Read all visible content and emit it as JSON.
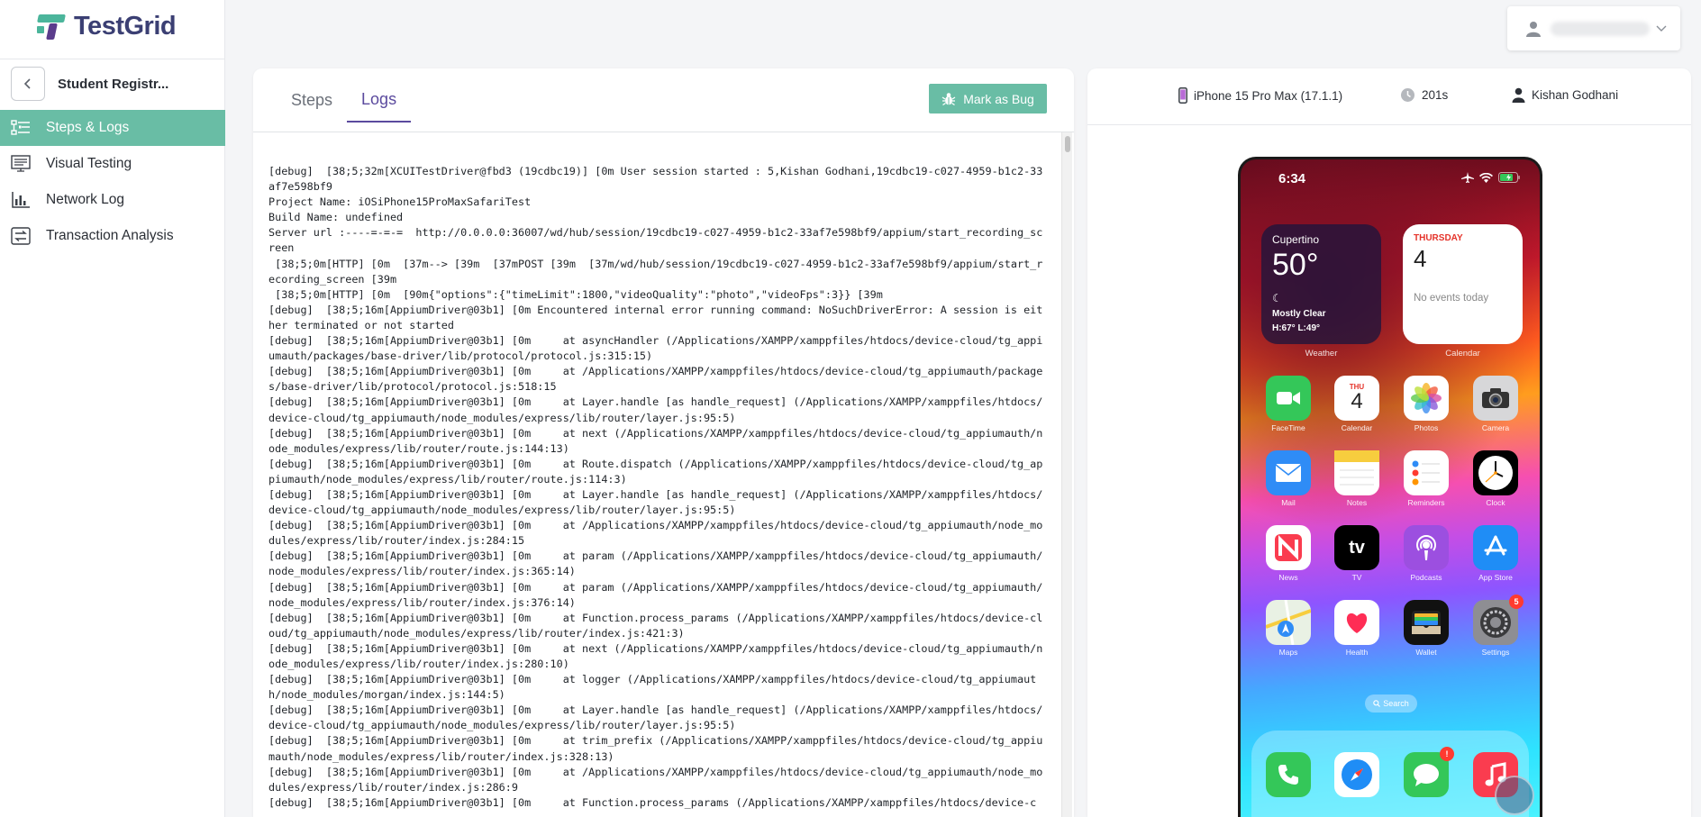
{
  "brand": {
    "name": "TestGrid"
  },
  "sidebar": {
    "project_name": "Student Registr...",
    "items": [
      {
        "label": "Steps & Logs",
        "icon": "steps-logs-icon",
        "active": true
      },
      {
        "label": "Visual Testing",
        "icon": "visual-testing-icon",
        "active": false
      },
      {
        "label": "Network Log",
        "icon": "network-log-icon",
        "active": false
      },
      {
        "label": "Transaction Analysis",
        "icon": "transaction-analysis-icon",
        "active": false
      }
    ]
  },
  "account": {
    "icon": "user-icon",
    "chevron": "chevron-down-icon"
  },
  "logs_panel": {
    "tabs": [
      {
        "label": "Steps",
        "active": false
      },
      {
        "label": "Logs",
        "active": true
      }
    ],
    "mark_bug_label": "Mark as Bug",
    "log_lines": [
      "[debug]  [38;5;32m[XCUITestDriver@fbd3 (19cdbc19)] [0m User session started : 5,Kishan Godhani,19cdbc19-c027-4959-b1c2-33af7e598bf9",
      "Project Name: iOSiPhone15ProMaxSafariTest",
      "Build Name: undefined",
      "Server url :----=-=-=  http://0.0.0.0:36007/wd/hub/session/19cdbc19-c027-4959-b1c2-33af7e598bf9/appium/start_recording_screen",
      " [38;5;0m[HTTP] [0m  [37m--> [39m  [37mPOST [39m  [37m/wd/hub/session/19cdbc19-c027-4959-b1c2-33af7e598bf9/appium/start_recording_screen [39m",
      " [38;5;0m[HTTP] [0m  [90m{\"options\":{\"timeLimit\":1800,\"videoQuality\":\"photo\",\"videoFps\":3}} [39m",
      "[debug]  [38;5;16m[AppiumDriver@03b1] [0m Encountered internal error running command: NoSuchDriverError: A session is either terminated or not started",
      "[debug]  [38;5;16m[AppiumDriver@03b1] [0m     at asyncHandler (/Applications/XAMPP/xamppfiles/htdocs/device-cloud/tg_appiumauth/packages/base-driver/lib/protocol/protocol.js:315:15)",
      "[debug]  [38;5;16m[AppiumDriver@03b1] [0m     at /Applications/XAMPP/xamppfiles/htdocs/device-cloud/tg_appiumauth/packages/base-driver/lib/protocol/protocol.js:518:15",
      "[debug]  [38;5;16m[AppiumDriver@03b1] [0m     at Layer.handle [as handle_request] (/Applications/XAMPP/xamppfiles/htdocs/device-cloud/tg_appiumauth/node_modules/express/lib/router/layer.js:95:5)",
      "[debug]  [38;5;16m[AppiumDriver@03b1] [0m     at next (/Applications/XAMPP/xamppfiles/htdocs/device-cloud/tg_appiumauth/node_modules/express/lib/router/route.js:144:13)",
      "[debug]  [38;5;16m[AppiumDriver@03b1] [0m     at Route.dispatch (/Applications/XAMPP/xamppfiles/htdocs/device-cloud/tg_appiumauth/node_modules/express/lib/router/route.js:114:3)",
      "[debug]  [38;5;16m[AppiumDriver@03b1] [0m     at Layer.handle [as handle_request] (/Applications/XAMPP/xamppfiles/htdocs/device-cloud/tg_appiumauth/node_modules/express/lib/router/layer.js:95:5)",
      "[debug]  [38;5;16m[AppiumDriver@03b1] [0m     at /Applications/XAMPP/xamppfiles/htdocs/device-cloud/tg_appiumauth/node_modules/express/lib/router/index.js:284:15",
      "[debug]  [38;5;16m[AppiumDriver@03b1] [0m     at param (/Applications/XAMPP/xamppfiles/htdocs/device-cloud/tg_appiumauth/node_modules/express/lib/router/index.js:365:14)",
      "[debug]  [38;5;16m[AppiumDriver@03b1] [0m     at param (/Applications/XAMPP/xamppfiles/htdocs/device-cloud/tg_appiumauth/node_modules/express/lib/router/index.js:376:14)",
      "[debug]  [38;5;16m[AppiumDriver@03b1] [0m     at Function.process_params (/Applications/XAMPP/xamppfiles/htdocs/device-cloud/tg_appiumauth/node_modules/express/lib/router/index.js:421:3)",
      "[debug]  [38;5;16m[AppiumDriver@03b1] [0m     at next (/Applications/XAMPP/xamppfiles/htdocs/device-cloud/tg_appiumauth/node_modules/express/lib/router/index.js:280:10)",
      "[debug]  [38;5;16m[AppiumDriver@03b1] [0m     at logger (/Applications/XAMPP/xamppfiles/htdocs/device-cloud/tg_appiumauth/node_modules/morgan/index.js:144:5)",
      "[debug]  [38;5;16m[AppiumDriver@03b1] [0m     at Layer.handle [as handle_request] (/Applications/XAMPP/xamppfiles/htdocs/device-cloud/tg_appiumauth/node_modules/express/lib/router/layer.js:95:5)",
      "[debug]  [38;5;16m[AppiumDriver@03b1] [0m     at trim_prefix (/Applications/XAMPP/xamppfiles/htdocs/device-cloud/tg_appiumauth/node_modules/express/lib/router/index.js:328:13)",
      "[debug]  [38;5;16m[AppiumDriver@03b1] [0m     at /Applications/XAMPP/xamppfiles/htdocs/device-cloud/tg_appiumauth/node_modules/express/lib/router/index.js:286:9",
      "[debug]  [38;5;16m[AppiumDriver@03b1] [0m     at Function.process_params (/Applications/XAMPP/xamppfiles/htdocs/device-c"
    ]
  },
  "device_panel": {
    "device_name": "iPhone 15 Pro Max (17.1.1)",
    "duration": "201s",
    "user": "Kishan Godhani"
  },
  "phone": {
    "time": "6:34",
    "weather": {
      "city": "Cupertino",
      "temp": "50°",
      "condition": "Mostly Clear",
      "hilo": "H:67° L:49°",
      "label": "Weather"
    },
    "calendar_widget": {
      "day": "THURSDAY",
      "date": "4",
      "events": "No events today",
      "label": "Calendar"
    },
    "apps": [
      {
        "label": "FaceTime",
        "icon": "facetime-icon",
        "bg": "#34c759"
      },
      {
        "label": "Calendar",
        "icon": "calendar-icon",
        "bg": "#ffffff",
        "day": "THU",
        "date": "4"
      },
      {
        "label": "Photos",
        "icon": "photos-icon",
        "bg": "#ffffff"
      },
      {
        "label": "Camera",
        "icon": "camera-icon",
        "bg": "#d7d7d9"
      },
      {
        "label": "Mail",
        "icon": "mail-icon",
        "bg": "#2f8cf6"
      },
      {
        "label": "Notes",
        "icon": "notes-icon",
        "bg": "#ffffff"
      },
      {
        "label": "Reminders",
        "icon": "reminders-icon",
        "bg": "#ffffff"
      },
      {
        "label": "Clock",
        "icon": "clock-icon",
        "bg": "#000000"
      },
      {
        "label": "News",
        "icon": "news-icon",
        "bg": "#ffffff"
      },
      {
        "label": "TV",
        "icon": "tv-icon",
        "bg": "#000000",
        "text": "tv"
      },
      {
        "label": "Podcasts",
        "icon": "podcasts-icon",
        "bg": "#9c4fe0"
      },
      {
        "label": "App Store",
        "icon": "app-store-icon",
        "bg": "#1f8df6"
      },
      {
        "label": "Maps",
        "icon": "maps-icon",
        "bg": "#e9f1e4"
      },
      {
        "label": "Health",
        "icon": "health-icon",
        "bg": "#ffffff"
      },
      {
        "label": "Wallet",
        "icon": "wallet-icon",
        "bg": "#111111"
      },
      {
        "label": "Settings",
        "icon": "settings-icon",
        "bg": "#8e8e93",
        "badge": "5"
      }
    ],
    "search_label": "Search",
    "dock": [
      {
        "icon": "phone-icon",
        "bg": "#34c759"
      },
      {
        "icon": "safari-icon",
        "bg": "#ffffff"
      },
      {
        "icon": "messages-icon",
        "bg": "#34c759",
        "badge": "!"
      },
      {
        "icon": "music-icon",
        "bg": "#fa3c4f"
      }
    ]
  },
  "colors": {
    "accent": "#69bda5",
    "brand_purple": "#5b4a9e",
    "brand_dark": "#3b3f73"
  }
}
